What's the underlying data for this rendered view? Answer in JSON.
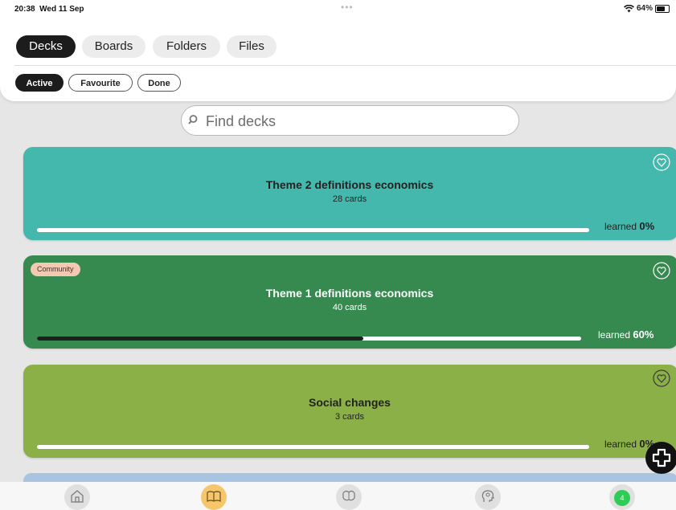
{
  "status_bar": {
    "time": "20:38",
    "date": "Wed 11 Sep",
    "battery": "64%",
    "battery_level": 0.64
  },
  "main_tabs": [
    {
      "label": "Decks",
      "active": true
    },
    {
      "label": "Boards",
      "active": false
    },
    {
      "label": "Folders",
      "active": false
    },
    {
      "label": "Files",
      "active": false
    }
  ],
  "filters": [
    {
      "label": "Active",
      "active": true
    },
    {
      "label": "Favourite",
      "active": false
    },
    {
      "label": "Done",
      "active": false
    }
  ],
  "search": {
    "placeholder": "Find decks"
  },
  "decks": [
    {
      "title": "Theme 2 definitions economics",
      "cards": "28 cards",
      "learned_label": "learned",
      "learned_value": "0%",
      "progress": 0.0,
      "color": "#45b8ae",
      "badge": ""
    },
    {
      "title": "Theme 1 definitions economics",
      "cards": "40 cards",
      "learned_label": "learned",
      "learned_value": "60%",
      "progress": 0.6,
      "color": "#368a4f",
      "badge": "Community"
    },
    {
      "title": "Social changes",
      "cards": "3 cards",
      "learned_label": "learned",
      "learned_value": "0%",
      "progress": 0.0,
      "color": "#8bb048",
      "badge": ""
    }
  ],
  "next_deck_color": "#a9c3e2",
  "bottom_nav": {
    "items": [
      "home-icon",
      "book-icon",
      "brain-icon",
      "head-icon",
      "notifications"
    ],
    "notification_count": "4",
    "accent": "#f5c76a"
  }
}
